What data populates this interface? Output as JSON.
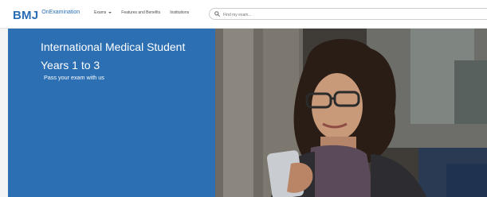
{
  "brand": {
    "logo_text": "BMJ",
    "product": "OnExamination",
    "accent": "#2c6fb3"
  },
  "nav": {
    "items": [
      {
        "label": "Exams",
        "has_dropdown": true
      },
      {
        "label": "Features and Benefits",
        "has_dropdown": false
      },
      {
        "label": "Institutions",
        "has_dropdown": false
      }
    ]
  },
  "search": {
    "placeholder": "Find my exam...",
    "icon": "search-icon"
  },
  "hero": {
    "title": "International Medical Student Years 1 to 3",
    "tagline": "Pass your exam with us"
  }
}
